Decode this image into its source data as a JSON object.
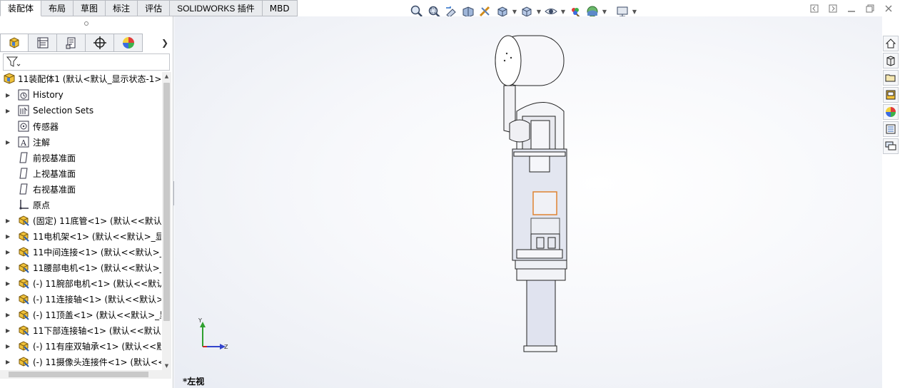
{
  "command_tabs": [
    "装配体",
    "布局",
    "草图",
    "标注",
    "评估",
    "SOLIDWORKS 插件",
    "MBD"
  ],
  "active_tab": "装配体",
  "hud_icons": [
    "zoom-to-fit-icon",
    "zoom-to-area-icon",
    "previous-view-icon",
    "section-view-icon",
    "dynamic-annotation-icon",
    "view-orientation-icon",
    "display-style-icon",
    "hide-show-items-icon",
    "edit-appearance-icon",
    "apply-scene-icon",
    "view-settings-icon"
  ],
  "window_buttons": [
    "restore-left-icon",
    "restore-right-icon",
    "minimize-icon",
    "maximize-icon",
    "close-icon"
  ],
  "panel_tabs": [
    "featuremanager-tab-icon",
    "propertymanager-tab-icon",
    "configurationmanager-tab-icon",
    "dimxpert-tab-icon",
    "display-manager-tab-icon"
  ],
  "tree": {
    "root": "11装配体1  (默认<默认_显示状态-1>)",
    "items": [
      {
        "label": "History",
        "icon": "history-icon",
        "expandable": true
      },
      {
        "label": "Selection Sets",
        "icon": "selection-sets-icon",
        "expandable": true
      },
      {
        "label": "传感器",
        "icon": "sensor-icon",
        "expandable": false
      },
      {
        "label": "注解",
        "icon": "annotation-icon",
        "expandable": true
      },
      {
        "label": "前视基准面",
        "icon": "plane-icon",
        "expandable": false
      },
      {
        "label": "上视基准面",
        "icon": "plane-icon",
        "expandable": false
      },
      {
        "label": "右视基准面",
        "icon": "plane-icon",
        "expandable": false
      },
      {
        "label": "原点",
        "icon": "origin-icon",
        "expandable": false
      },
      {
        "label": "(固定) 11底管<1> (默认<<默认",
        "icon": "part-icon",
        "expandable": true
      },
      {
        "label": "11电机架<1> (默认<<默认>_显",
        "icon": "part-icon",
        "expandable": true
      },
      {
        "label": "11中间连接<1> (默认<<默认>_",
        "icon": "part-icon",
        "expandable": true
      },
      {
        "label": "11腰部电机<1> (默认<<默认>_",
        "icon": "part-icon",
        "expandable": true
      },
      {
        "label": "(-) 11腕部电机<1> (默认<<默认",
        "icon": "part-icon",
        "expandable": true
      },
      {
        "label": "(-) 11连接轴<1> (默认<<默认>",
        "icon": "part-icon",
        "expandable": true
      },
      {
        "label": "(-) 11顶盖<1> (默认<<默认>_显",
        "icon": "part-icon",
        "expandable": true
      },
      {
        "label": "11下部连接轴<1> (默认<<默认",
        "icon": "part-icon",
        "expandable": true
      },
      {
        "label": "(-) 11有座双轴承<1> (默认<<默",
        "icon": "part-icon",
        "expandable": true
      },
      {
        "label": "(-) 11摄像头连接件<1> (默认<<",
        "icon": "part-icon",
        "expandable": true
      }
    ]
  },
  "viewport": {
    "view_name": "*左视",
    "triad": {
      "y_label": "Y",
      "z_label": "Z"
    }
  },
  "task_pane_icons": [
    "solidworks-resources-icon",
    "design-library-icon",
    "file-explorer-icon",
    "view-palette-icon",
    "appearances-icon",
    "custom-properties-icon",
    "forum-icon"
  ]
}
